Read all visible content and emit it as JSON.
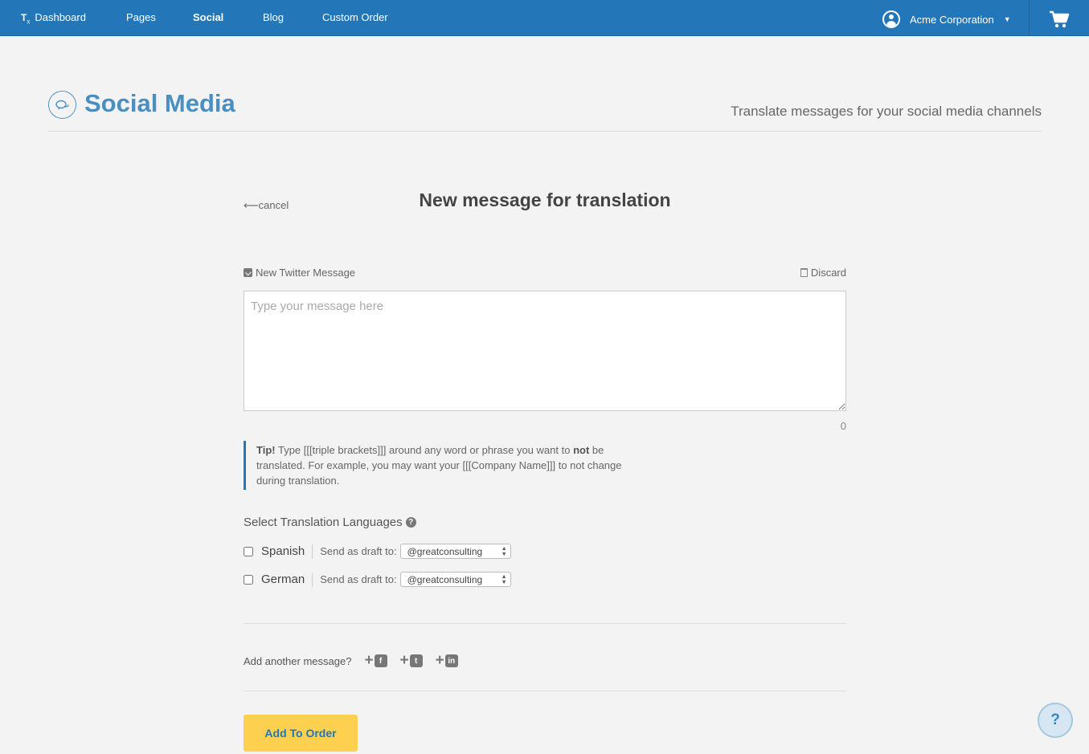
{
  "nav": {
    "logo": "T",
    "logo_sub": "x",
    "items": [
      {
        "label": "Dashboard"
      },
      {
        "label": "Pages"
      },
      {
        "label": "Social"
      },
      {
        "label": "Blog"
      },
      {
        "label": "Custom Order"
      }
    ],
    "active": "Social",
    "account": "Acme Corporation",
    "icons": {
      "account": "user-circle-icon",
      "caret": "caret-down-icon",
      "cart": "shopping-cart-icon"
    }
  },
  "header": {
    "title": "Social Media",
    "subtitle": "Translate messages for your social media channels",
    "icon": "chat-bubbles-icon"
  },
  "form": {
    "cancel": "cancel",
    "title": "New message for translation",
    "message_label": "New Twitter Message",
    "discard": "Discard",
    "placeholder": "Type your message here",
    "message_value": "",
    "char_count": "0",
    "tip": {
      "lead": "Tip!",
      "text1": " Type [[[triple brackets]]] around any word or phrase you want to ",
      "bold": "not",
      "text2": " be translated. For example, you may want your [[[Company Name]]] to not change during translation."
    },
    "languages_heading": "Select Translation Languages",
    "languages": [
      {
        "name": "Spanish",
        "checked": false,
        "draft_label": "Send as draft to:",
        "draft_value": "@greatconsulting"
      },
      {
        "name": "German",
        "checked": false,
        "draft_label": "Send as draft to:",
        "draft_value": "@greatconsulting"
      }
    ],
    "add_another": "Add another message?",
    "add_icons": [
      "facebook-icon",
      "twitter-icon",
      "linkedin-icon"
    ],
    "submit": "Add To Order"
  },
  "help_button": "?",
  "colors": {
    "nav": "#2376b8",
    "title": "#4a8fc2",
    "button": "#fdd04f",
    "background": "#f3f3f3"
  }
}
